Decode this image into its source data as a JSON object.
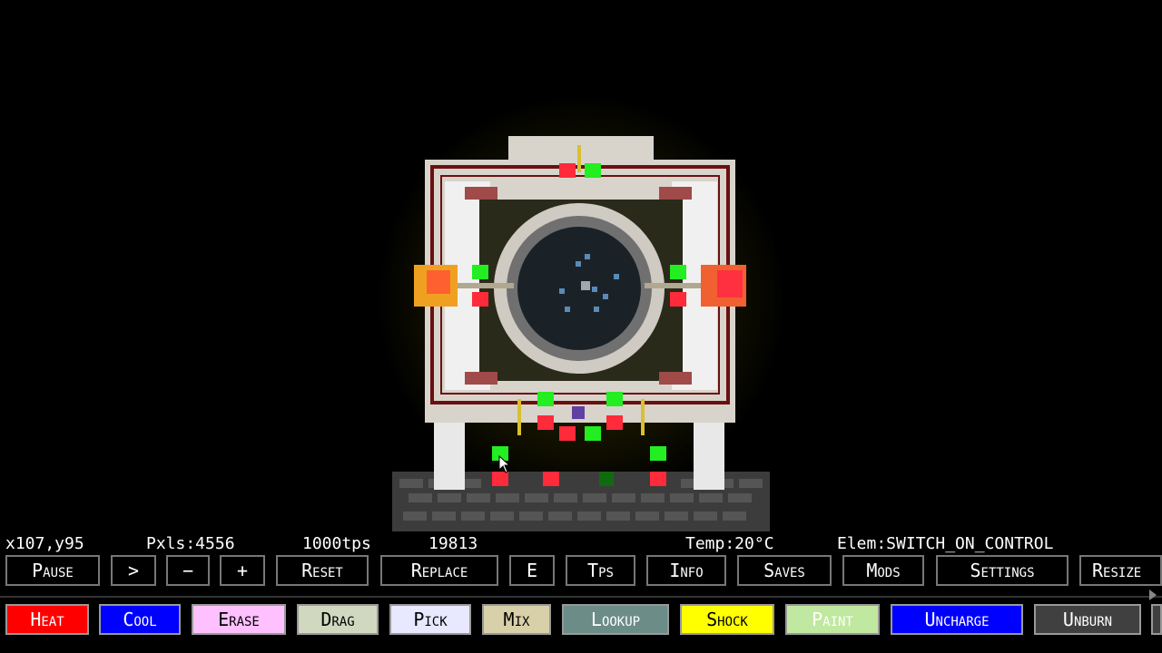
{
  "status": {
    "coords": "x107,y95",
    "pixels": "Pxls:4556",
    "tps": "1000tps",
    "ticks": "19813",
    "temp": "Temp:20°C",
    "elem": "Elem:SWITCH_ON_CONTROL"
  },
  "toolbar": [
    "Pause",
    ">",
    "−",
    "+",
    "Reset",
    "Replace",
    "E",
    "Tps",
    "Info",
    "Saves",
    "Mods",
    "Settings",
    "Resize"
  ],
  "tools": [
    {
      "label": "Heat",
      "bg": "#ff0000",
      "fg": "#ffffff"
    },
    {
      "label": "Cool",
      "bg": "#0000ff",
      "fg": "#ffffff"
    },
    {
      "label": "Erase",
      "bg": "#ffc0ff",
      "fg": "#000000"
    },
    {
      "label": "Drag",
      "bg": "#d0d8c0",
      "fg": "#000000"
    },
    {
      "label": "Pick",
      "bg": "#e8e8ff",
      "fg": "#000000"
    },
    {
      "label": "Mix",
      "bg": "#d8d0a8",
      "fg": "#000000"
    },
    {
      "label": "Lookup",
      "bg": "#6c8c88",
      "fg": "#ffffff"
    },
    {
      "label": "Shock",
      "bg": "#ffff00",
      "fg": "#000000"
    },
    {
      "label": "Paint",
      "bg": "#c0e8a0",
      "fg": "#ffffff"
    },
    {
      "label": "Uncharge",
      "bg": "#0000ff",
      "fg": "#ffffff"
    },
    {
      "label": "Unburn",
      "bg": "#404040",
      "fg": "#ffffff"
    },
    {
      "label": "",
      "bg": "#404040",
      "fg": "#ffffff"
    }
  ]
}
